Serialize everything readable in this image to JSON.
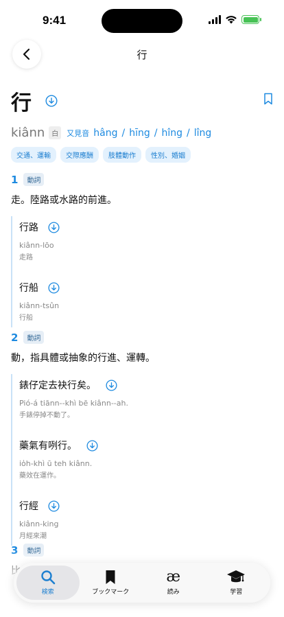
{
  "status": {
    "time": "9:41"
  },
  "nav": {
    "title": "行"
  },
  "entry": {
    "headword": "行",
    "romanization": "kiânn",
    "bai_label": "白",
    "alt_label": "又見音",
    "alt_readings": [
      "hâng",
      "hīng",
      "hîng",
      "lîng"
    ],
    "tags": [
      "交通、運輸",
      "交際應酬",
      "肢體動作",
      "性別、婚姻"
    ]
  },
  "senses": [
    {
      "num": "1",
      "pos": "動詞",
      "definition": "走。陸路或水路的前進。",
      "examples": [
        {
          "text": "行路",
          "roman": "kiânn-lōo",
          "trans": "走路"
        },
        {
          "text": "行船",
          "roman": "kiânn-tsûn",
          "trans": "行船"
        }
      ]
    },
    {
      "num": "2",
      "pos": "動詞",
      "definition": "動，指具體或抽象的行進、運轉。",
      "examples": [
        {
          "text": "錶仔定去袂行矣。",
          "roman": "Pió-á tiānn--khì bē kiânn--ah.",
          "trans": "手錶停掉不動了。"
        },
        {
          "text": "藥氣有咧行。",
          "roman": "io̍h-khì ū teh kiânn.",
          "trans": "藥效在運作。"
        },
        {
          "text": "行經",
          "roman": "kiânn-king",
          "trans": "月經來潮"
        }
      ]
    },
    {
      "num": "3",
      "pos": "動詞",
      "definition": "比"
    }
  ],
  "tabbar": {
    "items": [
      {
        "label": "検索",
        "icon": "search-icon"
      },
      {
        "label": "ブックマーク",
        "icon": "bookmark-icon"
      },
      {
        "label": "読み",
        "icon": "ae-icon",
        "glyph": "æ"
      },
      {
        "label": "学習",
        "icon": "graduation-cap-icon"
      }
    ]
  },
  "colors": {
    "accent": "#1d8ae0",
    "tag_bg": "#e3f1fd",
    "battery": "#47c255"
  }
}
